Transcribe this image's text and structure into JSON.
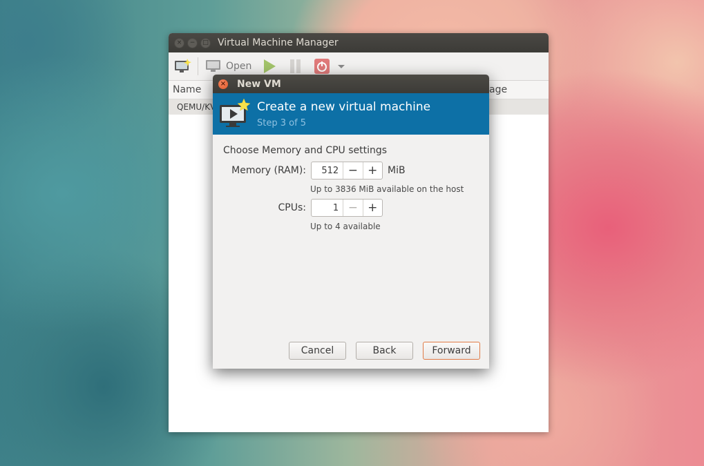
{
  "main_window": {
    "title": "Virtual Machine Manager",
    "toolbar": {
      "open_label": "Open"
    },
    "columns": {
      "name": "Name",
      "usage": "age"
    },
    "rows": [
      "QEMU/KV"
    ]
  },
  "dialog": {
    "title": "New VM",
    "header": {
      "title": "Create a new virtual machine",
      "step": "Step 3 of 5"
    },
    "section_title": "Choose Memory and CPU settings",
    "memory": {
      "label": "Memory (RAM):",
      "value": "512",
      "unit": "MiB",
      "hint": "Up to 3836 MiB available on the host"
    },
    "cpus": {
      "label": "CPUs:",
      "value": "1",
      "hint": "Up to 4 available"
    },
    "buttons": {
      "cancel": "Cancel",
      "back": "Back",
      "forward": "Forward"
    },
    "spin_glyphs": {
      "minus": "−",
      "plus": "+"
    }
  },
  "colors": {
    "banner": "#0d70a6",
    "accent": "#e07a45",
    "titlebar": "#3c3b37"
  }
}
